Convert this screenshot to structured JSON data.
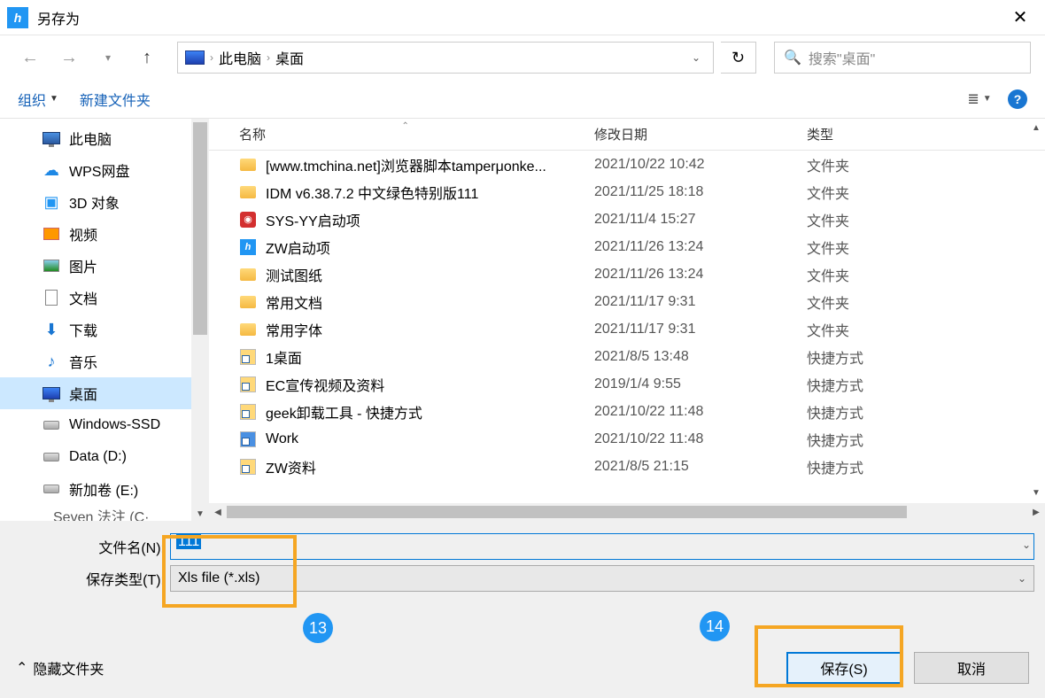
{
  "window": {
    "title": "另存为"
  },
  "breadcrumb": {
    "root": "此电脑",
    "current": "桌面"
  },
  "search": {
    "placeholder": "搜索\"桌面\""
  },
  "toolbar": {
    "organize": "组织",
    "newfolder": "新建文件夹"
  },
  "sidebar": {
    "items": [
      {
        "label": "此电脑",
        "icon": "pc"
      },
      {
        "label": "WPS网盘",
        "icon": "wps"
      },
      {
        "label": "3D 对象",
        "icon": "3d"
      },
      {
        "label": "视频",
        "icon": "video"
      },
      {
        "label": "图片",
        "icon": "pic"
      },
      {
        "label": "文档",
        "icon": "doc"
      },
      {
        "label": "下载",
        "icon": "dl"
      },
      {
        "label": "音乐",
        "icon": "music"
      },
      {
        "label": "桌面",
        "icon": "desk",
        "selected": true
      },
      {
        "label": "Windows-SSD",
        "icon": "disk"
      },
      {
        "label": "Data (D:)",
        "icon": "disk"
      },
      {
        "label": "新加卷 (E:)",
        "icon": "disk"
      }
    ],
    "cutoff": "Seven 法注 (C·"
  },
  "columns": {
    "name": "名称",
    "date": "修改日期",
    "type": "类型"
  },
  "files": [
    {
      "name": "[www.tmchina.net]浏览器脚本tamperμonke...",
      "date": "2021/10/22 10:42",
      "type": "文件夹",
      "icon": "folder"
    },
    {
      "name": "IDM v6.38.7.2  中文绿色特别版111",
      "date": "2021/11/25 18:18",
      "type": "文件夹",
      "icon": "folder"
    },
    {
      "name": "SYS-YY启动项",
      "date": "2021/11/4 15:27",
      "type": "文件夹",
      "icon": "red"
    },
    {
      "name": "ZW启动项",
      "date": "2021/11/26 13:24",
      "type": "文件夹",
      "icon": "app"
    },
    {
      "name": "测试图纸",
      "date": "2021/11/26 13:24",
      "type": "文件夹",
      "icon": "folder"
    },
    {
      "name": "常用文档",
      "date": "2021/11/17 9:31",
      "type": "文件夹",
      "icon": "folder"
    },
    {
      "name": "常用字体",
      "date": "2021/11/17 9:31",
      "type": "文件夹",
      "icon": "folder"
    },
    {
      "name": "1桌面",
      "date": "2021/8/5 13:48",
      "type": "快捷方式",
      "icon": "shortcut"
    },
    {
      "name": "EC宣传视频及资料",
      "date": "2019/1/4 9:55",
      "type": "快捷方式",
      "icon": "shortcut"
    },
    {
      "name": "geek卸载工具 - 快捷方式",
      "date": "2021/10/22 11:48",
      "type": "快捷方式",
      "icon": "shortcut"
    },
    {
      "name": "Work",
      "date": "2021/10/22 11:48",
      "type": "快捷方式",
      "icon": "shortcut-b"
    },
    {
      "name": "ZW资料",
      "date": "2021/8/5 21:15",
      "type": "快捷方式",
      "icon": "shortcut"
    }
  ],
  "form": {
    "filename_label": "文件名(N):",
    "filename_value": "111",
    "filetype_label": "保存类型(T):",
    "filetype_value": "Xls file (*.xls)"
  },
  "footer": {
    "hide_folders": "隐藏文件夹",
    "save": "保存(S)",
    "cancel": "取消"
  },
  "badges": {
    "b13": "13",
    "b14": "14"
  }
}
